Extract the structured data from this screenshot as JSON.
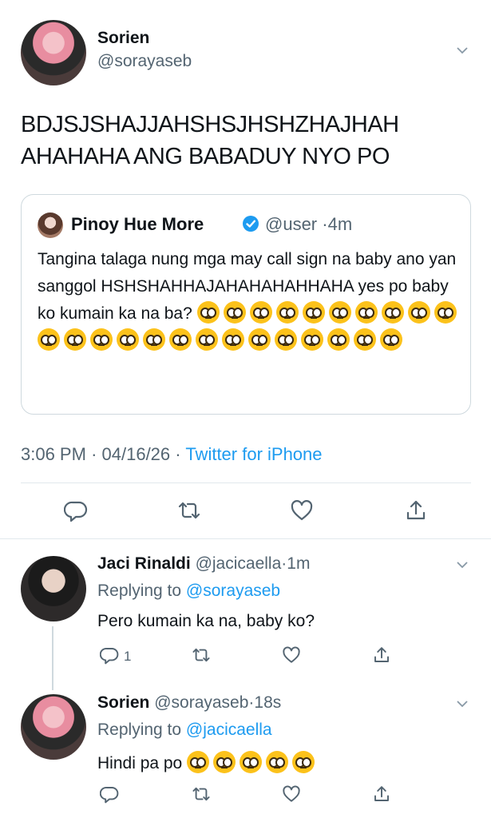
{
  "main_tweet": {
    "author_name": "Sorien",
    "author_handle": "@sorayaseb",
    "text": "BDJSJSHAJJAHSHSJHSHZHAJHAH AHAHAHA ANG BABADUY NYO PO",
    "quote": {
      "author_name": "Pinoy Hue More",
      "handle": "@user",
      "time": "4m",
      "text": "Tangina talaga nung mga may call sign na baby ano yan sanggol HSHSHAHHAJAHAHAHAHHAHA yes po baby ko kumain ka na ba?",
      "emoji_count": 24
    },
    "time": "3:06 PM",
    "date": "04/16/26",
    "client": "Twitter for iPhone"
  },
  "replies": [
    {
      "author_name": "Jaci Rinaldi",
      "author_handle": "@jacicaella",
      "time": "1m",
      "replying_prefix": "Replying to",
      "replying_to": "@sorayaseb",
      "text": "Pero kumain ka na, baby ko?",
      "reply_count": "1"
    },
    {
      "author_name": "Sorien",
      "author_handle": "@sorayaseb",
      "time": "18s",
      "replying_prefix": "Replying to",
      "replying_to": "@jacicaella",
      "text": "Hindi pa po",
      "emoji_count": 5
    }
  ],
  "separator": "·",
  "icons": [
    "chevron-down-icon",
    "verified-icon",
    "reply-icon",
    "retweet-icon",
    "like-icon",
    "share-icon",
    "pleading-face-emoji"
  ],
  "colors": {
    "link": "#1d9bf0",
    "secondary_text": "#536471",
    "verified": "#1d9bf0",
    "emoji": "#fcc21b"
  }
}
